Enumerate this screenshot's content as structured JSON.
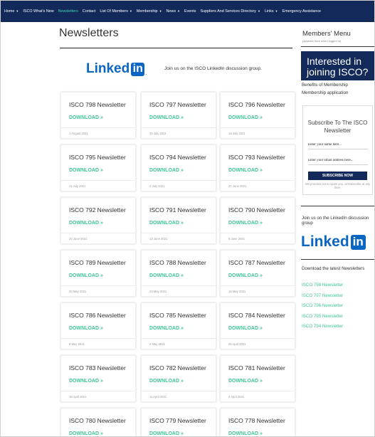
{
  "nav": {
    "items": [
      {
        "label": "Home",
        "caret": true
      },
      {
        "label": "ISCO What's New",
        "caret": false
      },
      {
        "label": "Newsletters",
        "caret": false,
        "active": true
      },
      {
        "label": "Contact",
        "caret": false
      },
      {
        "label": "List Of Members",
        "caret": true
      },
      {
        "label": "Membership",
        "caret": true
      },
      {
        "label": "News",
        "caret": true
      },
      {
        "label": "Events",
        "caret": false
      },
      {
        "label": "Suppliers And Services Directory",
        "caret": true
      },
      {
        "label": "Links",
        "caret": true
      },
      {
        "label": "Emergency Assistance",
        "caret": false
      }
    ],
    "caret_glyph": "▼",
    "active_color": "#3fd6b4",
    "background_color": "#12295a"
  },
  "main": {
    "title": "Newsletters",
    "linkedin_banner": {
      "logo_text": "Linked",
      "logo_box": "in",
      "logo_dot": ".",
      "text": "Join us on the ISCO LinkedIn discussion group."
    },
    "download_label": "DOWNLOAD »",
    "accent_color": "#3fc49a",
    "newsletters": [
      {
        "title": "ISCO 798 Newsletter",
        "date": "1 August 2021"
      },
      {
        "title": "ISCO 797 Newsletter",
        "date": "25 July 2021"
      },
      {
        "title": "ISCO 796 Newsletter",
        "date": "18 July 2021"
      },
      {
        "title": "ISCO 795 Newsletter",
        "date": "11 July 2021"
      },
      {
        "title": "ISCO 794 Newsletter",
        "date": "4 July 2021"
      },
      {
        "title": "ISCO 793 Newsletter",
        "date": "27 June 2021"
      },
      {
        "title": "ISCO 792 Newsletter",
        "date": "20 June 2021"
      },
      {
        "title": "ISCO 791 Newsletter",
        "date": "13 June 2021"
      },
      {
        "title": "ISCO 790 Newsletter",
        "date": "6 June 2021"
      },
      {
        "title": "ISCO 789 Newsletter",
        "date": "30 May 2021"
      },
      {
        "title": "ISCO 788 Newsletter",
        "date": "23 May 2021"
      },
      {
        "title": "ISCO 787 Newsletter",
        "date": "16 May 2021"
      },
      {
        "title": "ISCO 786 Newsletter",
        "date": "9 May 2021"
      },
      {
        "title": "ISCO 785 Newsletter",
        "date": "2 May 2021"
      },
      {
        "title": "ISCO 784 Newsletter",
        "date": "25 April 2021"
      },
      {
        "title": "ISCO 783 Newsletter",
        "date": "18 April 2021"
      },
      {
        "title": "ISCO 782 Newsletter",
        "date": "11 April 2021"
      },
      {
        "title": "ISCO 781 Newsletter",
        "date": "4 April 2021"
      },
      {
        "title": "ISCO 780 Newsletter",
        "date": ""
      },
      {
        "title": "ISCO 779 Newsletter",
        "date": ""
      },
      {
        "title": "ISCO 778 Newsletter",
        "date": ""
      }
    ]
  },
  "sidebar": {
    "members_menu": "Members' Menu",
    "members_note": "(appears here when logged in)",
    "join_heading": "Interested in joining ISCO?",
    "benefits_link": "Benefits of Membership",
    "application_link": "Membership application",
    "subscribe": {
      "title": "Subscribe To The ISCO Newsletter",
      "name_placeholder": "Enter your name here...",
      "email_placeholder": "Enter your email address here...",
      "button": "SUBSCRIBE NOW",
      "promise": "We promise not to spam you. Unsubscribe at any time."
    },
    "linkedin_join": "Join us on the LinkedIn discussion group",
    "linkedin_logo": {
      "text": "Linked",
      "box": "in",
      "dot": "."
    },
    "download_heading": "Download the latest Newsletters",
    "latest_links": [
      "ISCO 798 Newsletter",
      "ISCO 797 Newsletter",
      "ISCO 796 Newsletter",
      "ISCO 795 Newsletter",
      "ISCO 794 Newsletter"
    ]
  }
}
